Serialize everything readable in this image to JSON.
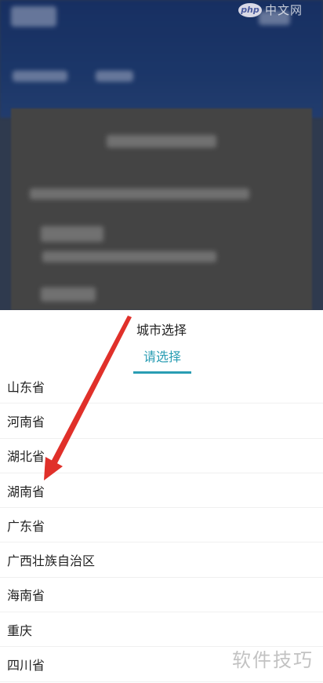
{
  "sheet": {
    "title": "城市选择",
    "tab_label": "请选择",
    "accent_color": "#2a9db3",
    "provinces": [
      "山东省",
      "河南省",
      "湖北省",
      "湖南省",
      "广东省",
      "广西壮族自治区",
      "海南省",
      "重庆",
      "四川省"
    ]
  },
  "annotation": {
    "color": "#e0302a",
    "icon": "arrow-icon"
  },
  "watermarks": {
    "top_logo": "php",
    "top_text": "中文网",
    "bottom_text": "软件技巧"
  }
}
